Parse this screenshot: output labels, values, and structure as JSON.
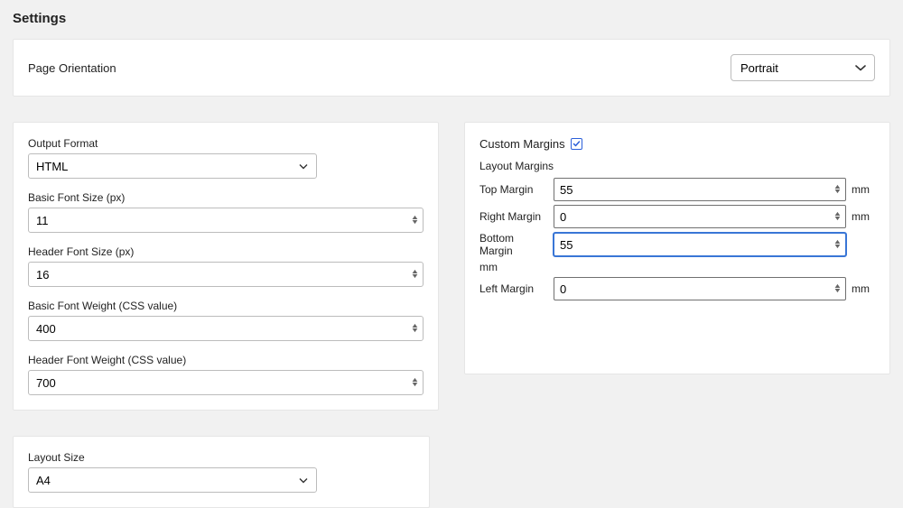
{
  "title": "Settings",
  "orientation": {
    "label": "Page Orientation",
    "value": "Portrait"
  },
  "output": {
    "format_label": "Output Format",
    "format_value": "HTML",
    "basic_font_size_label": "Basic Font Size (px)",
    "basic_font_size_value": "11",
    "header_font_size_label": "Header Font Size (px)",
    "header_font_size_value": "16",
    "basic_font_weight_label": "Basic Font Weight (CSS value)",
    "basic_font_weight_value": "400",
    "header_font_weight_label": "Header Font Weight (CSS value)",
    "header_font_weight_value": "700"
  },
  "margins": {
    "custom_label": "Custom Margins",
    "custom_checked": true,
    "layout_label": "Layout Margins",
    "top_label": "Top Margin",
    "top_value": "55",
    "right_label": "Right Margin",
    "right_value": "0",
    "bottom_label": "Bottom Margin",
    "bottom_value": "55",
    "left_label": "Left Margin",
    "left_value": "0",
    "unit": "mm"
  },
  "layout_size": {
    "label": "Layout Size",
    "value": "A4"
  }
}
